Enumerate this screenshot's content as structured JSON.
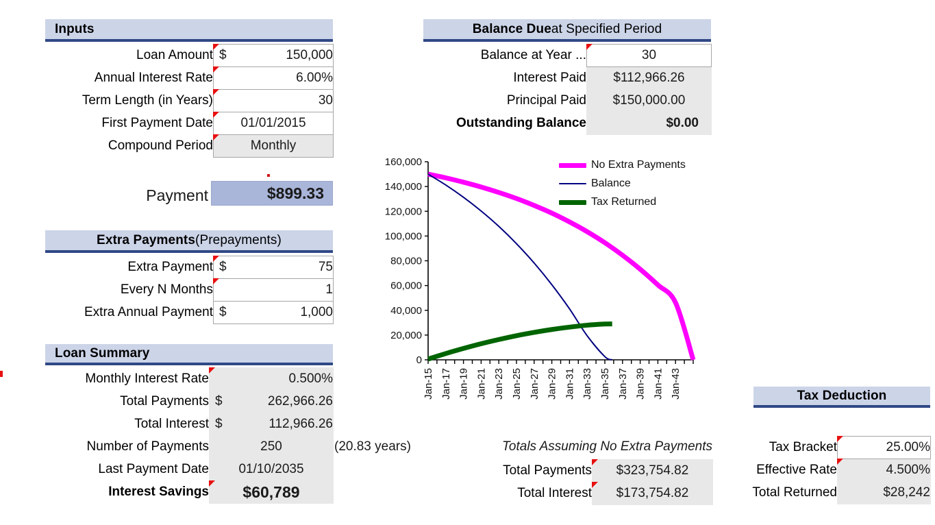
{
  "inputs": {
    "title": "Inputs",
    "rows": [
      {
        "label": "Loan Amount",
        "currency": "$",
        "value": "150,000",
        "editable": true
      },
      {
        "label": "Annual Interest Rate",
        "currency": "",
        "value": "6.00%",
        "editable": true
      },
      {
        "label": "Term Length (in Years)",
        "currency": "",
        "value": "30",
        "editable": true
      },
      {
        "label": "First Payment Date",
        "currency": "",
        "value": "01/01/2015",
        "editable": true
      },
      {
        "label": "Compound Period",
        "currency": "",
        "value": "Monthly",
        "editable": true
      }
    ]
  },
  "payment": {
    "label": "Payment",
    "value": "$899.33"
  },
  "extra_payments": {
    "title_bold": "Extra Payments",
    "title_rest": " (Prepayments)",
    "rows": [
      {
        "label": "Extra Payment",
        "currency": "$",
        "value": "75"
      },
      {
        "label": "Every N Months",
        "currency": "",
        "value": "1"
      },
      {
        "label": "Extra Annual Payment",
        "currency": "$",
        "value": "1,000"
      }
    ]
  },
  "loan_summary": {
    "title": "Loan Summary",
    "note": "(20.83 years)",
    "rows": [
      {
        "label": "Monthly Interest Rate",
        "currency": "",
        "value": "0.500%",
        "align": "right",
        "bold": false
      },
      {
        "label": "Total Payments",
        "currency": "$",
        "value": "262,966.26",
        "align": "right",
        "bold": false
      },
      {
        "label": "Total Interest",
        "currency": "$",
        "value": "112,966.26",
        "align": "right",
        "bold": false
      },
      {
        "label": "Number of Payments",
        "currency": "",
        "value": "250",
        "align": "center",
        "bold": false
      },
      {
        "label": "Last Payment Date",
        "currency": "",
        "value": "01/10/2035",
        "align": "center",
        "bold": false
      },
      {
        "label": "Interest Savings",
        "currency": "",
        "value": "$60,789",
        "align": "center",
        "bold": true
      }
    ]
  },
  "balance_due": {
    "title_bold": "Balance Due",
    "title_rest": " at Specified Period",
    "rows": [
      {
        "label": "Balance at Year ...",
        "value": "30",
        "editable": true,
        "align": "center",
        "bold": false
      },
      {
        "label": "Interest Paid",
        "value": "$112,966.26",
        "editable": false,
        "align": "center",
        "bold": false
      },
      {
        "label": "Principal Paid",
        "value": "$150,000.00",
        "editable": false,
        "align": "center",
        "bold": false
      },
      {
        "label": "Outstanding Balance",
        "value": "$0.00",
        "editable": false,
        "align": "right",
        "bold": true
      }
    ]
  },
  "totals_no_extra": {
    "title": "Totals Assuming No Extra Payments",
    "rows": [
      {
        "label": "Total Payments",
        "value": "$323,754.82"
      },
      {
        "label": "Total Interest",
        "value": "$173,754.82"
      }
    ]
  },
  "tax_deduction": {
    "title": "Tax Deduction",
    "rows": [
      {
        "label": "Tax Bracket",
        "value": "25.00%",
        "editable": true
      },
      {
        "label": "Effective Rate",
        "value": "4.500%",
        "editable": false
      },
      {
        "label": "Total Returned",
        "value": "$28,242",
        "editable": false
      }
    ]
  },
  "chart_data": {
    "type": "line",
    "title": "",
    "xlabel": "",
    "ylabel": "",
    "grid": false,
    "legend_position": "top-right",
    "ylim": [
      0,
      160000
    ],
    "yticks": [
      "0",
      "20,000",
      "40,000",
      "60,000",
      "80,000",
      "100,000",
      "120,000",
      "140,000",
      "160,000"
    ],
    "ytick_values": [
      0,
      20000,
      40000,
      60000,
      80000,
      100000,
      120000,
      140000,
      160000
    ],
    "xticks": [
      "Jan-15",
      "Jan-17",
      "Jan-19",
      "Jan-21",
      "Jan-23",
      "Jan-25",
      "Jan-27",
      "Jan-29",
      "Jan-31",
      "Jan-33",
      "Jan-35",
      "Jan-37",
      "Jan-39",
      "Jan-41",
      "Jan-43"
    ],
    "xtick_years": [
      2015,
      2017,
      2019,
      2021,
      2023,
      2025,
      2027,
      2029,
      2031,
      2033,
      2035,
      2037,
      2039,
      2041,
      2043
    ],
    "xlim_years": [
      2015,
      2045
    ],
    "series": [
      {
        "name": "No Extra Payments",
        "color": "#FF00FF",
        "width": 7,
        "x_years": [
          2015,
          2017,
          2019,
          2021,
          2023,
          2025,
          2027,
          2029,
          2031,
          2033,
          2035,
          2037,
          2039,
          2041,
          2043,
          2045
        ],
        "values": [
          150000,
          147000,
          143500,
          139600,
          135200,
          130300,
          124700,
          118500,
          111400,
          103500,
          94600,
          84500,
          73200,
          60500,
          46200,
          0
        ]
      },
      {
        "name": "Balance",
        "color": "#000080",
        "width": 2,
        "x_years": [
          2015,
          2017,
          2019,
          2021,
          2023,
          2025,
          2027,
          2029,
          2031,
          2033,
          2035,
          2035.83
        ],
        "values": [
          150000,
          141200,
          131300,
          120200,
          107800,
          93800,
          78200,
          60700,
          41200,
          19400,
          2600,
          0
        ]
      },
      {
        "name": "Tax Returned",
        "color": "#006400",
        "width": 7,
        "x_years": [
          2015,
          2017,
          2019,
          2021,
          2023,
          2025,
          2027,
          2029,
          2031,
          2033,
          2035,
          2035.83
        ],
        "values": [
          600,
          5100,
          9200,
          13000,
          16400,
          19500,
          22200,
          24500,
          26400,
          28000,
          28900,
          29000
        ]
      }
    ]
  }
}
